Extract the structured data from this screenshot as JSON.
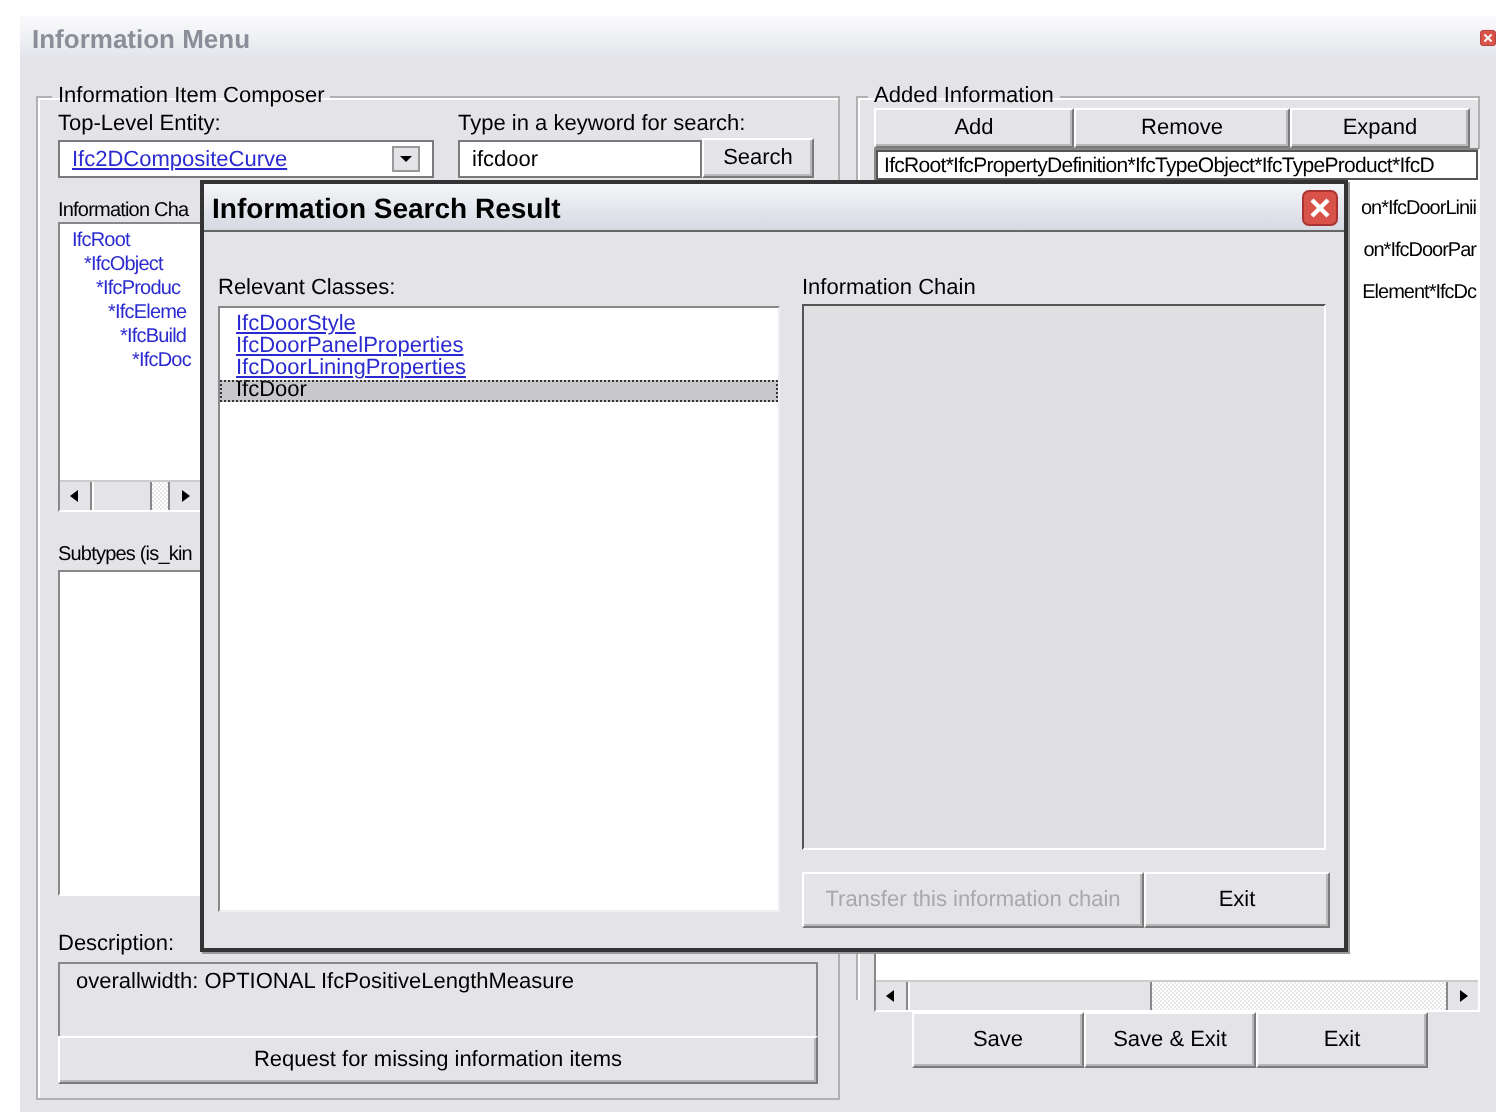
{
  "window": {
    "title": "Information Menu"
  },
  "composer": {
    "title": "Information Item Composer",
    "top_level_label": "Top-Level Entity:",
    "top_level_value": "Ifc2DCompositeCurve",
    "keyword_label": "Type in a keyword for search:",
    "keyword_value": "ifcdoor",
    "search_button": "Search",
    "chain_label": "Information Cha",
    "chain_tree": [
      {
        "label": "IfcRoot",
        "children": [
          {
            "label": "*IfcObject",
            "children": [
              {
                "label": "*IfcProduc",
                "children": [
                  {
                    "label": "*IfcEleme",
                    "children": [
                      {
                        "label": "*IfcBuild",
                        "children": [
                          {
                            "label": "*IfcDoc"
                          }
                        ]
                      }
                    ]
                  }
                ]
              }
            ]
          }
        ]
      }
    ],
    "subtypes_label": "Subtypes (is_kin",
    "description_label": "Description:",
    "description": "overallwidth: OPTIONAL IfcPositiveLengthMeasure",
    "request_button": "Request for missing information items"
  },
  "added": {
    "title": "Added Information",
    "buttons": [
      "Add",
      "Remove",
      "Expand"
    ],
    "items": [
      {
        "text": "IfcRoot*IfcPropertyDefinition*IfcTypeObject*IfcTypeProduct*IfcD",
        "selected": true
      },
      {
        "text": "on*IfcDoorLinii",
        "selected": false
      },
      {
        "text": "on*IfcDoorPar",
        "selected": false
      },
      {
        "text": "Element*IfcDc",
        "selected": false
      }
    ]
  },
  "footer_buttons": [
    "Save",
    "Save & Exit",
    "Exit"
  ],
  "dialog": {
    "title": "Information Search Result",
    "classes_label": "Relevant Classes:",
    "classes": [
      {
        "label": "IfcDoorStyle",
        "selected": false
      },
      {
        "label": "IfcDoorPanelProperties",
        "selected": false
      },
      {
        "label": "IfcDoorLiningProperties",
        "selected": false
      },
      {
        "label": "IfcDoor",
        "selected": true
      }
    ],
    "chain_label": "Information Chain",
    "buttons": [
      {
        "label": "Transfer this information chain",
        "disabled": true
      },
      {
        "label": "Exit",
        "disabled": false
      }
    ]
  }
}
